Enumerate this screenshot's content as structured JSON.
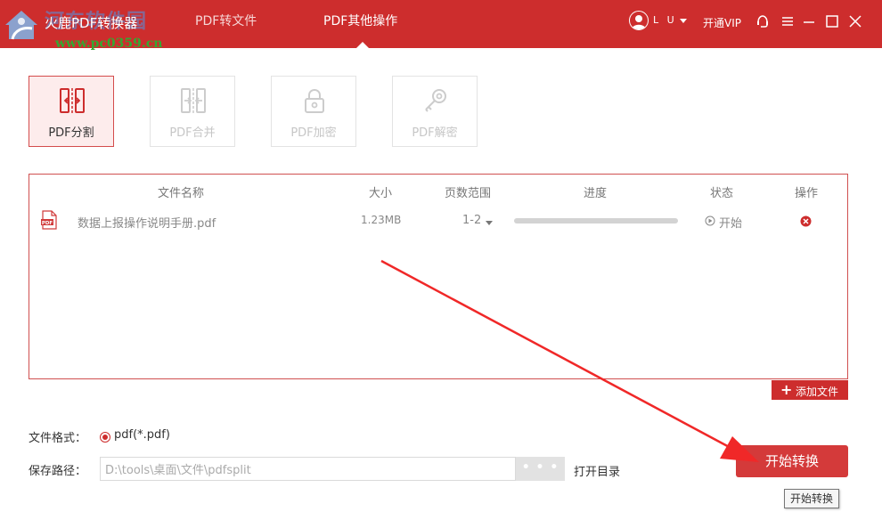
{
  "app": {
    "title": "火鹿PDF转换器",
    "watermark_title": "河东软件园",
    "watermark_url": "www.pc0359.cn"
  },
  "nav": {
    "tabs": [
      {
        "label": "PDF转文件",
        "active": false
      },
      {
        "label": "PDF其他操作",
        "active": true
      }
    ]
  },
  "user": {
    "name": "L U",
    "vip_label": "开通VIP"
  },
  "tools": [
    {
      "label": "PDF分割",
      "icon": "split-icon",
      "active": true
    },
    {
      "label": "PDF合并",
      "icon": "merge-icon",
      "active": false
    },
    {
      "label": "PDF加密",
      "icon": "lock-icon",
      "active": false
    },
    {
      "label": "PDF解密",
      "icon": "key-icon",
      "active": false
    }
  ],
  "table": {
    "headers": {
      "name": "文件名称",
      "size": "大小",
      "pages": "页数范围",
      "progress": "进度",
      "status": "状态",
      "action": "操作"
    },
    "rows": [
      {
        "icon": "pdf-file-icon",
        "name": "数据上报操作说明手册.pdf",
        "size": "1.23MB",
        "pages": "1-2",
        "progress": 0,
        "status": "开始"
      }
    ]
  },
  "add_file_label": "添加文件",
  "settings": {
    "format_label": "文件格式：",
    "format_option": "pdf(*.pdf)",
    "path_label": "保存路径：",
    "path_value": "D:\\tools\\桌面\\文件\\pdfsplit",
    "browse_label": "• • •",
    "open_dir_label": "打开目录"
  },
  "convert_label": "开始转换",
  "tooltip_text": "开始转换",
  "colors": {
    "brand_red": "#cd2d2d",
    "annotation_arrow": "#f02828"
  }
}
